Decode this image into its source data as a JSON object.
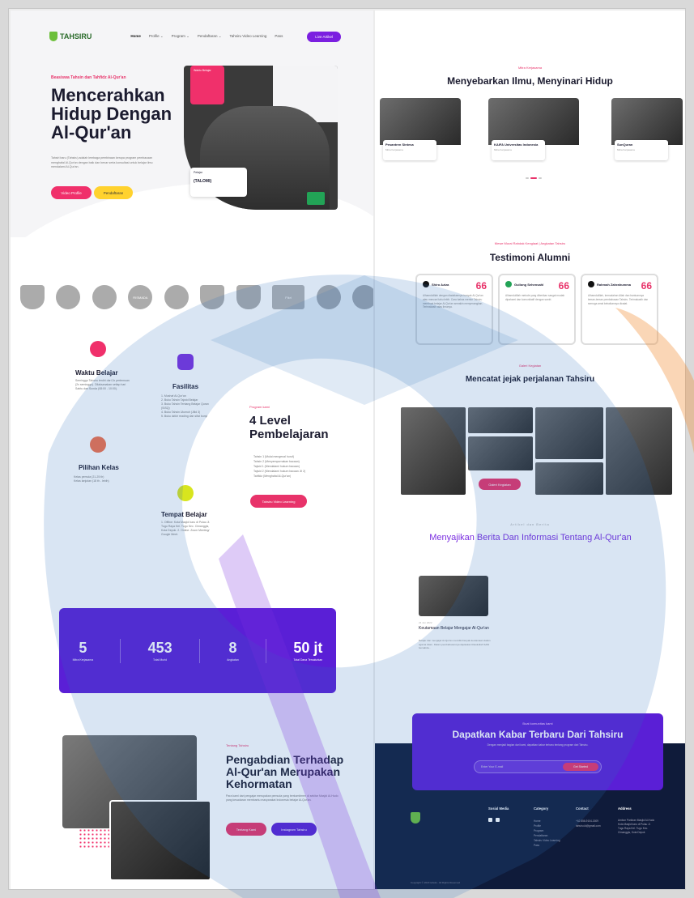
{
  "nav": {
    "brand": "TAHSIRU",
    "links": [
      "Home",
      "Profile ⌄",
      "Program ⌄",
      "Pendaftaran ⌄",
      "Tahsiru Video Learning",
      "Pass"
    ],
    "cta": "Live Artikel"
  },
  "hero": {
    "kicker": "Beasiswa Tahsin dan Tahfidz Al-Qur'an",
    "title": "Mencerahkan Hidup Dengan Al-Qur'an",
    "description": "Tahsiri baru (Tahsiru) adalah lembaga pembinaan kerupa program pembacaan menghafal Al-Qur'an dengan baik dan benar serta konsultasi untuk belajar ilmu mendalami Al-Qur'an.",
    "btn_video": "Video Profile",
    "btn_register": "Pendaftaran",
    "card_pink": "Waktu Belajar",
    "stat_label": "Pelajar",
    "stat_value": "(TALOMI)"
  },
  "logos": [
    "",
    "",
    "",
    "RISMADA",
    "",
    "",
    "",
    "Fikri",
    "",
    ""
  ],
  "features": {
    "waktu": {
      "title": "Waktu Belajar",
      "desc": "Seminggu Tahsiru terdiri dari 2x pertemuan (2x seminggu). Dilaksanakan setiap hari Sabtu dan Sunda (08:00 - 10:00)."
    },
    "fasilitas": {
      "title": "Fasilitas",
      "items": [
        "1. Mushaf Al-Qur'an",
        "2. Buku Tahsin Tajwid Belajar",
        "3. Buku Tahsin Tentang Belajar Quran (SISQ)",
        "4. Buku Tahsin Ulumuh (Jilid 3)",
        "5. Buku dzikir reading dan sifat bunyi"
      ]
    },
    "pilihan": {
      "title": "Pilihan Kelas",
      "items": [
        "Kelas pemula (21-25 th)",
        "Kelas lanjutan (18 th - lebih)"
      ]
    },
    "tempat": {
      "title": "Tempat Belajar",
      "desc": "1. Offline: Kota Masjid baru di Pulau Jl. Tugu Raya Kel. Tugu Kec. Cimanggis, Kota Depok. 2. Online: Zoom Meeting/ Google Meet."
    }
  },
  "program": {
    "kicker": "Program kami",
    "title": "4 Level Pembelajaran",
    "levels": [
      "Tahsin 1 (Mulai mengenal huruf)",
      "Tahsin 2 (Menyempurnakan bacaan)",
      "Tajwid 1 (Mendalami hukum bacaan)",
      "Tajwid 2 (Mendalami hukum bacaan Jil 2)",
      "Tahfidz (Menghafal Al-Qur'an)"
    ],
    "button": "Tahsiru Video Learning"
  },
  "stats": [
    {
      "num": "5",
      "label": "Mitra Kerjasama"
    },
    {
      "num": "453",
      "label": "Total Murid"
    },
    {
      "num": "8",
      "label": "Angkatan"
    },
    {
      "num": "50 jt",
      "label": "Total Dana Tersalurkan"
    }
  ],
  "about": {
    "kicker": "Tentang Tahsiru",
    "title": "Pengabdian Terhadap Al-Qur'an Merupakan Kehormatan",
    "desc": "Para kami dari pengajar merupakan pemuda yang berkomitmen di sekitar Masjid Al-Hudo yang kesadaran membantu masyarakat Indonesia belajar Al-Qur'an.",
    "btn1": "Tentang Kami",
    "btn2": "Instagram Tahsiru"
  },
  "partners": {
    "kicker": "Mitra Kerjasama",
    "title": "Menyebarkan Ilmu, Menyinari Hidup",
    "cards": [
      {
        "name": "Pesantren Sintesa",
        "sub": "Mitra Kerjasama"
      },
      {
        "name": "KAIFA Universitas Indonesia",
        "sub": "Mitra Kerjasama"
      },
      {
        "name": "SunQuran",
        "sub": "Mitra Kerjasama"
      }
    ]
  },
  "testimonials": {
    "kicker": "Mewe Murai Rahdak Kenglaat | Angkatan Tahsiru",
    "title": "Testimoni Alumni",
    "items": [
      {
        "name": "Shiro Aziza",
        "text": "Alhamdulillah dengan diadakannya banyak Al-Qur'an atau mencari tahu lebih. Cara bahas mentor Tahsiru membuat belajar Al-Qur'an semakin menyenangkan. Terimakasih atas ilmunya."
      },
      {
        "name": "Guilong Sehensahl",
        "text": "Alhamdulillah metode yang diberikan sangat mudah dipahami dan komunikatif dengan santri."
      },
      {
        "name": "Rahmah Zahrahumma",
        "text": "Alhamdulillah, kemudahan Allah dan bantuannya teman-teman pembahasan Tahsiru. Terimakasih dan semoga amal kebaikannya dicatat."
      }
    ]
  },
  "gallery": {
    "kicker": "Galeri Kegiatan",
    "title": "Mencatat jejak perjalanan Tahsiru",
    "button": "Galeri Kegiatan"
  },
  "news": {
    "kicker": "Artikel dan Berita",
    "title": "Menyajikan Berita Dan Informasi Tentang Al-Qur'an",
    "item_date": "24 Jun 2022",
    "item_title": "Keutamaan Belajar Mengajar Al-Qur'an",
    "item_desc": "Belajar dan mengajar Al-Qur'an memiliki banyak keutamaan dalam agama Islam. Dalam pembahasannya dijelaskan Rasulullah SAW bersabda..."
  },
  "newsletter": {
    "kicker": "Buat komunitas kami",
    "title": "Dapatkan Kabar Terbaru Dari Tahsiru",
    "desc": "Dengan menjadi bagian dari kami, dapatkan kabar terbaru tentang program dari Tahsiru.",
    "placeholder": "Enter Your E-mail",
    "button": "Get Started"
  },
  "footer": {
    "social_title": "Sosial Media",
    "category_title": "Category",
    "category_items": [
      "Home",
      "Profile",
      "Program",
      "Pendaftaran",
      "Tahsiru Video Learning",
      "Pass"
    ],
    "contact_title": "Contact",
    "contact_items": [
      "+62 856-9104-1509",
      "tahsiru.id@gmail.com"
    ],
    "address_title": "Address",
    "address_text": "Ambon Parkiran Masjid Al-Hudo Kota Masjid baru di Pulau Jl. Tugu Raya Kel. Tugu Kec. Cimanggis, Kota Depok",
    "copyright": "Copyright © 2023 tahsiru. All Rights Reserved"
  },
  "colors": {
    "primary_pink": "#e8336a",
    "primary_purple": "#5a1fd6",
    "yellow": "#ffd22e",
    "footer_navy": "#0f1b3a",
    "watermark_blue": "#2f6fbf"
  }
}
